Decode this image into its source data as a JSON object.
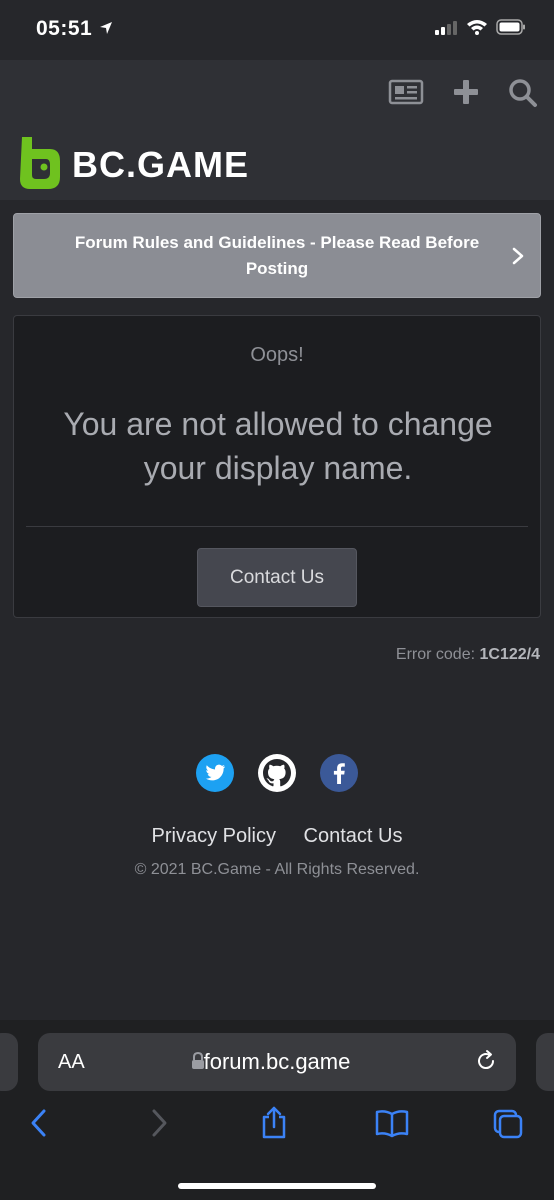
{
  "status_bar": {
    "time": "05:51"
  },
  "logo": {
    "text": "BC.GAME",
    "accent": "#6fc21f"
  },
  "banner": {
    "text": "Forum Rules and Guidelines - Please Read Before Posting"
  },
  "error_card": {
    "heading": "Oops!",
    "message": "You are not allowed to change your display name.",
    "button_label": "Contact Us"
  },
  "error_code": {
    "label": "Error code:",
    "value": "1C122/4"
  },
  "footer": {
    "links": [
      "Privacy Policy",
      "Contact Us"
    ],
    "copyright": "© 2021 BC.Game - All Rights Reserved.",
    "social_icons": [
      "twitter-icon",
      "github-icon",
      "facebook-icon"
    ]
  },
  "safari": {
    "aa_label": "AA",
    "url": "forum.bc.game",
    "toolbar_icons": [
      "back-icon",
      "forward-icon",
      "share-icon",
      "bookmarks-icon",
      "tabs-icon"
    ]
  },
  "colors": {
    "background": "#26272b",
    "link_blue": "#3b82f6",
    "twitter": "#1da1f2",
    "facebook": "#3b5998"
  }
}
